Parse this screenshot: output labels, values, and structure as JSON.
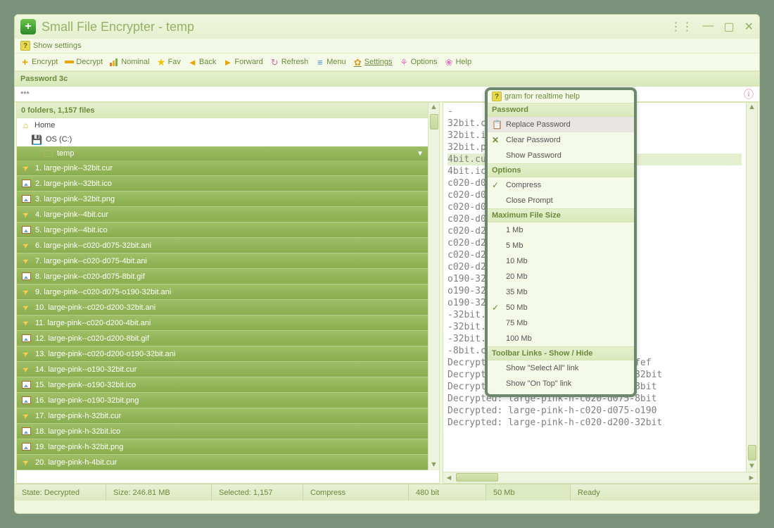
{
  "window": {
    "title": "Small File Encrypter - temp"
  },
  "hint": "Show settings",
  "toolbar": {
    "encrypt": "Encrypt",
    "decrypt": "Decrypt",
    "nominal": "Nominal",
    "fav": "Fav",
    "back": "Back",
    "forward": "Forward",
    "refresh": "Refresh",
    "menu": "Menu",
    "settings": "Settings",
    "options": "Options",
    "help": "Help"
  },
  "password": {
    "label": "Password 3c",
    "value": "***"
  },
  "left": {
    "header": "0 folders, 1,157 files",
    "nav": {
      "home": "Home",
      "drive": "OS (C:)",
      "folder": "temp"
    },
    "files": [
      "1. large-pink--32bit.cur",
      "2. large-pink--32bit.ico",
      "3. large-pink--32bit.png",
      "4. large-pink--4bit.cur",
      "5. large-pink--4bit.ico",
      "6. large-pink--c020-d075-32bit.ani",
      "7. large-pink--c020-d075-4bit.ani",
      "8. large-pink--c020-d075-8bit.gif",
      "9. large-pink--c020-d075-o190-32bit.ani",
      "10. large-pink--c020-d200-32bit.ani",
      "11. large-pink--c020-d200-4bit.ani",
      "12. large-pink--c020-d200-8bit.gif",
      "13. large-pink--c020-d200-o190-32bit.ani",
      "14. large-pink--o190-32bit.cur",
      "15. large-pink--o190-32bit.ico",
      "16. large-pink--o190-32bit.png",
      "17. large-pink-h-32bit.cur",
      "18. large-pink-h-32bit.ico",
      "19. large-pink-h-32bit.png",
      "20. large-pink-h-4bit.cur"
    ],
    "file_icons": [
      "cur",
      "ico",
      "png",
      "cur",
      "ico",
      "ani",
      "ani",
      "gif",
      "ani",
      "ani",
      "ani",
      "gif",
      "ani",
      "cur",
      "ico",
      "png",
      "cur",
      "ico",
      "png",
      "cur"
    ]
  },
  "log": {
    "lines": [
      "-",
      "32bit.cur.sfef",
      "32bit.ico.sfef",
      "32bit.png.sfef",
      "4bit.cur.sfef",
      "4bit.ico.sfef",
      "c020-d075-32bit",
      "c020-d075-4bit.",
      "c020-d075-8bit.",
      "c020-d075-o190-",
      "c020-d200-32bit",
      "c020-d200-4bit.",
      "c020-d200-8bit.",
      "c020-d200-o190-",
      "o190-32bit.cur.",
      "o190-32bit.ico.",
      "o190-32bit.png.",
      "-32bit.cur.sfef",
      "-32bit.ico.sfef",
      "-32bit.png.sfef",
      "-8bit.cur.sfef",
      "Decrypted: large-pink-h-8bit.ico.sfef",
      "Decrypted: large-pink-h-c020-d075-32bit",
      "Decrypted: large-pink-h-c020-d075-8bit",
      "Decrypted: large-pink-h-c020-d075-8bit",
      "Decrypted: large-pink-h-c020-d075-o190",
      "Decrypted: large-pink-h-c020-d200-32bit"
    ],
    "selected_index": 4
  },
  "popup": {
    "hint": "gram for realtime help",
    "groups": {
      "password": "Password",
      "options": "Options",
      "maxsize": "Maximum File Size",
      "links": "Toolbar Links - Show / Hide"
    },
    "password_items": {
      "replace": "Replace Password",
      "clear": "Clear Password",
      "show": "Show Password"
    },
    "option_items": {
      "compress": "Compress",
      "closeprompt": "Close Prompt"
    },
    "size_items": [
      "1 Mb",
      "5 Mb",
      "10 Mb",
      "20 Mb",
      "35 Mb",
      "50 Mb",
      "75 Mb",
      "100 Mb"
    ],
    "size_checked": "50 Mb",
    "link_items": {
      "selectall": "Show \"Select All\" link",
      "ontop": "Show \"On Top\" link"
    }
  },
  "status": {
    "state": "State: Decrypted",
    "size": "Size: 246.81 MB",
    "selected": "Selected: 1,157",
    "compress": "Compress",
    "bit": "480 bit",
    "maxsize": "50 Mb",
    "ready": "Ready"
  }
}
